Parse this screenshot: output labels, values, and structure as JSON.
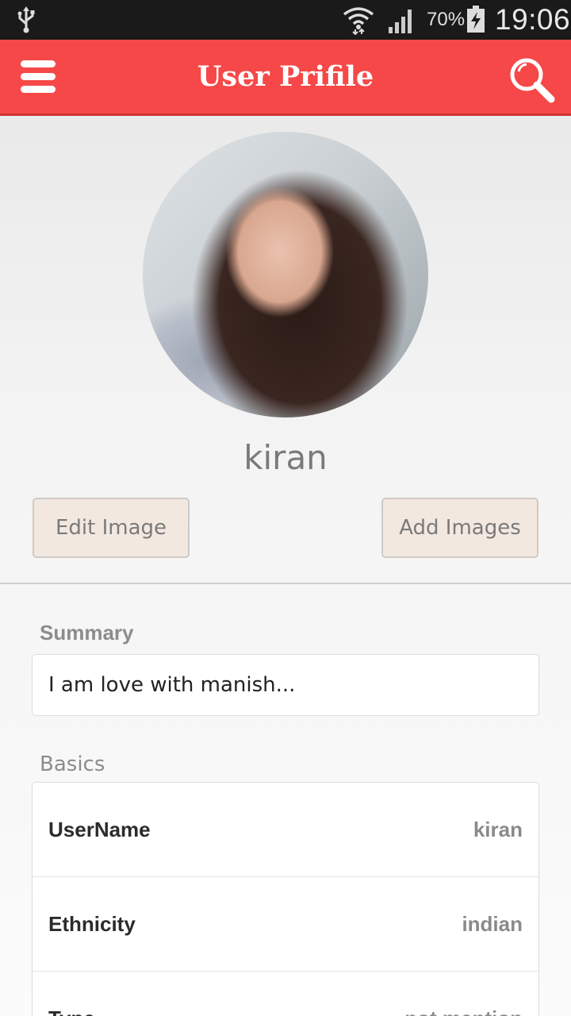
{
  "status_bar": {
    "battery": "70%",
    "time": "19:06",
    "icons": [
      "usb-icon",
      "wifi-icon",
      "signal-icon",
      "battery-charging-icon"
    ]
  },
  "app_bar": {
    "title": "User Prifile",
    "icons": [
      "menu-icon",
      "search-icon"
    ],
    "color": "#f64848"
  },
  "profile": {
    "name": "kiran",
    "edit_image_label": "Edit Image",
    "add_images_label": "Add Images"
  },
  "summary": {
    "label": "Summary",
    "text": "I am love with manish..."
  },
  "basics": {
    "label": "Basics",
    "rows": [
      {
        "key": "UserName",
        "value": "kiran"
      },
      {
        "key": "Ethnicity",
        "value": "indian"
      },
      {
        "key": "Type",
        "value": "not mention"
      }
    ]
  }
}
